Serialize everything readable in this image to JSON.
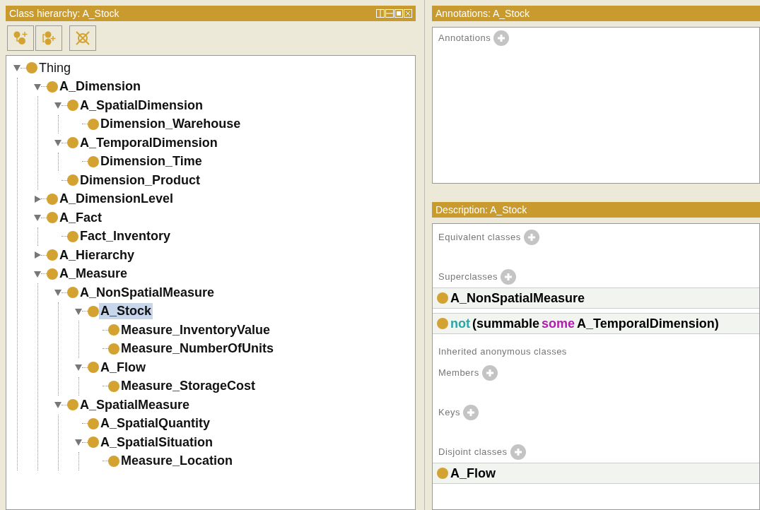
{
  "class_hierarchy": {
    "title": "Class hierarchy: A_Stock",
    "tree": [
      {
        "label": "Thing",
        "selected": false,
        "expanded": true,
        "children": [
          {
            "label": "A_Dimension",
            "selected": false,
            "expanded": true,
            "children": [
              {
                "label": "A_SpatialDimension",
                "selected": false,
                "expanded": true,
                "children": [
                  {
                    "label": "Dimension_Warehouse",
                    "selected": false
                  }
                ]
              },
              {
                "label": "A_TemporalDimension",
                "selected": false,
                "expanded": true,
                "children": [
                  {
                    "label": "Dimension_Time",
                    "selected": false
                  }
                ]
              },
              {
                "label": "Dimension_Product",
                "selected": false
              }
            ]
          },
          {
            "label": "A_DimensionLevel",
            "selected": false,
            "expanded": false
          },
          {
            "label": "A_Fact",
            "selected": false,
            "expanded": true,
            "children": [
              {
                "label": "Fact_Inventory",
                "selected": false
              }
            ]
          },
          {
            "label": "A_Hierarchy",
            "selected": false,
            "expanded": false
          },
          {
            "label": "A_Measure",
            "selected": false,
            "expanded": true,
            "children": [
              {
                "label": "A_NonSpatialMeasure",
                "selected": false,
                "expanded": true,
                "children": [
                  {
                    "label": "A_Stock",
                    "selected": true,
                    "expanded": true,
                    "children": [
                      {
                        "label": "Measure_InventoryValue",
                        "selected": false
                      },
                      {
                        "label": "Measure_NumberOfUnits",
                        "selected": false
                      }
                    ]
                  },
                  {
                    "label": "A_Flow",
                    "selected": false,
                    "expanded": true,
                    "children": [
                      {
                        "label": "Measure_StorageCost",
                        "selected": false
                      }
                    ]
                  }
                ]
              },
              {
                "label": "A_SpatialMeasure",
                "selected": false,
                "expanded": true,
                "children": [
                  {
                    "label": "A_SpatialQuantity",
                    "selected": false
                  },
                  {
                    "label": "A_SpatialSituation",
                    "selected": false,
                    "expanded": true,
                    "children": [
                      {
                        "label": "Measure_Location",
                        "selected": false
                      }
                    ]
                  }
                ]
              }
            ]
          }
        ]
      }
    ]
  },
  "annotations": {
    "title": "Annotations: A_Stock",
    "sections": [
      {
        "label": "Annotations"
      }
    ]
  },
  "description": {
    "title": "Description: A_Stock",
    "sections": [
      {
        "label": "Equivalent classes",
        "addable": true
      },
      {
        "label": "Superclasses",
        "addable": true,
        "entries": [
          [
            {
              "text": "A_NonSpatialMeasure",
              "color": "#000000"
            }
          ],
          [
            {
              "text": "not",
              "color": "#2aa6a6"
            },
            {
              "text": "(summable",
              "color": "#000000"
            },
            {
              "text": "some",
              "color": "#b01eb0"
            },
            {
              "text": "A_TemporalDimension)",
              "color": "#000000"
            }
          ]
        ]
      },
      {
        "label": "Inherited anonymous classes",
        "addable": false
      },
      {
        "label": "Members",
        "addable": true
      },
      {
        "label": "Keys",
        "addable": true
      },
      {
        "label": "Disjoint classes",
        "addable": true,
        "entries": [
          [
            {
              "text": "A_Flow",
              "color": "#000000"
            }
          ]
        ]
      }
    ]
  }
}
